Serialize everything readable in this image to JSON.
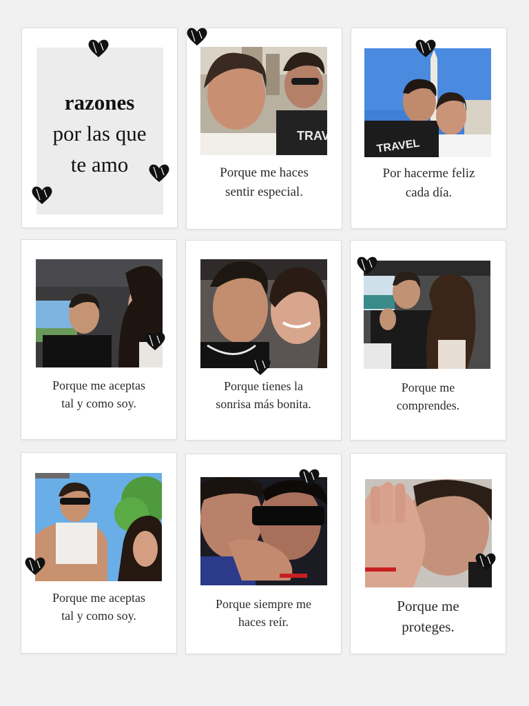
{
  "title": {
    "line1": "razones",
    "line2": "por las que",
    "line3": "te amo"
  },
  "cards": [
    {
      "line1": "Porque me haces",
      "line2": "sentir especial."
    },
    {
      "line1": "Por hacerme feliz",
      "line2": "cada día."
    },
    {
      "line1": "Porque me aceptas",
      "line2": "tal y como soy."
    },
    {
      "line1": "Porque tienes la",
      "line2": "sonrisa más bonita."
    },
    {
      "line1": "Porque me",
      "line2": "comprendes."
    },
    {
      "line1": "Porque me aceptas",
      "line2": "tal y como soy."
    },
    {
      "line1": "Porque siempre me",
      "line2": "haces reír."
    },
    {
      "line1": "Porque me",
      "line2": "proteges."
    }
  ],
  "icons": {
    "decoration": "heart-icon",
    "photo": "selfie-photo"
  }
}
